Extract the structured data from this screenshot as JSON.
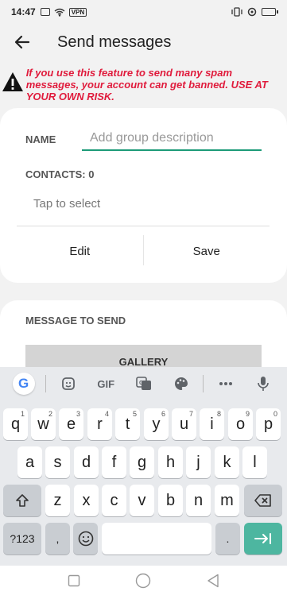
{
  "status": {
    "time": "14:47",
    "vpn": "VPN"
  },
  "appbar": {
    "title": "Send messages"
  },
  "warning": {
    "text": "If you use this feature to send many spam messages, your account can get banned. USE AT YOUR OWN RISK."
  },
  "group": {
    "name_label": "NAME",
    "name_placeholder": "Add group description",
    "contacts_label": "CONTACTS: 0",
    "tap_select": "Tap to select",
    "edit_label": "Edit",
    "save_label": "Save"
  },
  "message": {
    "label": "MESSAGE TO SEND",
    "gallery_label": "GALLERY"
  },
  "keyboard": {
    "toolbar": {
      "google": "G",
      "gif": "GIF"
    },
    "row1": [
      {
        "k": "q",
        "h": "1"
      },
      {
        "k": "w",
        "h": "2"
      },
      {
        "k": "e",
        "h": "3"
      },
      {
        "k": "r",
        "h": "4"
      },
      {
        "k": "t",
        "h": "5"
      },
      {
        "k": "y",
        "h": "6"
      },
      {
        "k": "u",
        "h": "7"
      },
      {
        "k": "i",
        "h": "8"
      },
      {
        "k": "o",
        "h": "9"
      },
      {
        "k": "p",
        "h": "0"
      }
    ],
    "row2": [
      "a",
      "s",
      "d",
      "f",
      "g",
      "h",
      "j",
      "k",
      "l"
    ],
    "row3": [
      "z",
      "x",
      "c",
      "v",
      "b",
      "n",
      "m"
    ],
    "symbols_label": "?123",
    "comma": ",",
    "period": "."
  },
  "colors": {
    "accent": "#1c9b78",
    "warning": "#e01b3c",
    "enter": "#4db6a0"
  }
}
